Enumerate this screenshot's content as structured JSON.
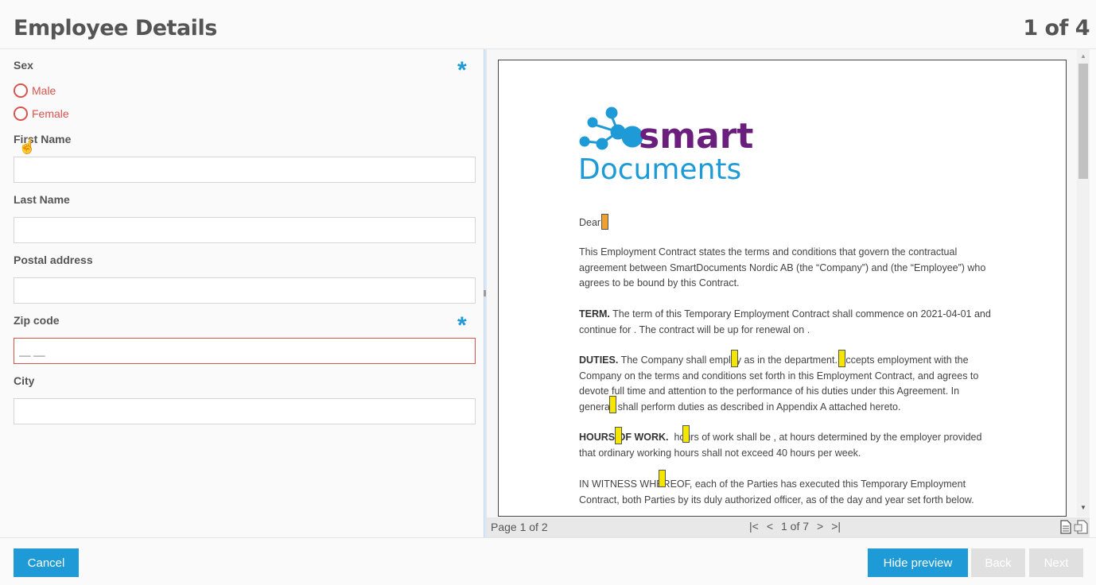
{
  "header": {
    "title": "Employee Details",
    "step": "1 of 4"
  },
  "form": {
    "sex_label": "Sex",
    "required_mark": "*",
    "options": [
      "Male",
      "Female"
    ],
    "first_name_label": "First Name",
    "last_name_label": "Last Name",
    "postal_label": "Postal address",
    "zip_label": "Zip code",
    "zip_placeholder": "__ __",
    "city_label": "City"
  },
  "preview": {
    "logo_top": "smart",
    "logo_bottom": "Documents",
    "dear": "Dear",
    "intro": "This Employment Contract states the terms and conditions that govern the contractual agreement between SmartDocuments Nordic AB (the “Company”) and   (the “Employee”) who agrees to be bound by this Contract.",
    "term_head": "TERM.",
    "term_text": "The term of this Temporary Employment Contract shall commence on 2021-04-01 and continue for . The contract will be up for renewal on .",
    "duties_head": "DUTIES.",
    "duties_text": "The Company shall employ as  in the  department.  accepts employment with the Company on the terms and conditions set forth in this Employment Contract, and agrees to devote full time and attention to the performance of his duties under this Agreement. In general, shall perform  duties as described in Appendix A attached hereto.",
    "hours_head": "HOURS OF WORK.",
    "hours_text": "hours of work shall be , at hours determined by the employer provided that ordinary working hours shall not exceed 40 hours per week.",
    "witness_text": "IN WITNESS WHEREOF, each of the Parties has executed this Temporary Employment Contract, both Parties by its duly authorized officer, as of the day and year set forth below.",
    "page_label": "Page 1 of 2",
    "nav_label": "1 of 7"
  },
  "footer": {
    "cancel": "Cancel",
    "hide_preview": "Hide preview",
    "back": "Back",
    "next": "Next"
  },
  "colors": {
    "accent": "#1e9ad6",
    "error": "#d9534f",
    "logo_purple": "#6b1f7c",
    "highlight": "#f5e600"
  }
}
